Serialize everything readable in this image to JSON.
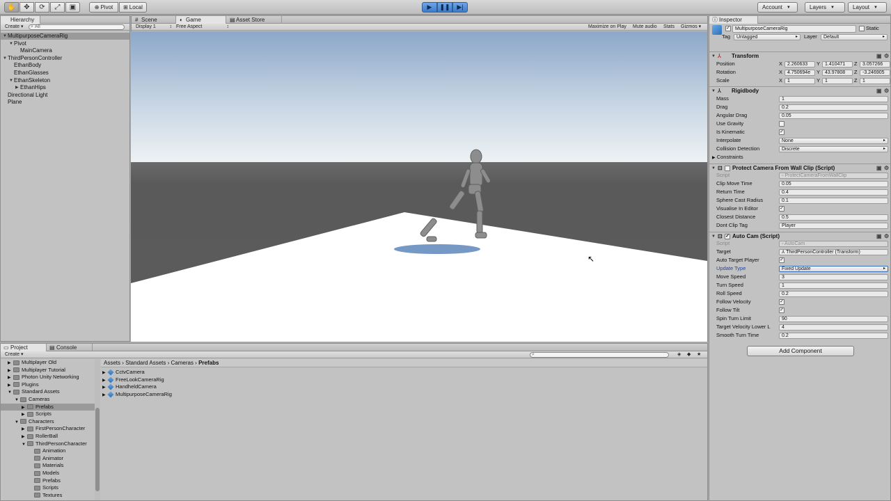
{
  "toolbar": {
    "tools": [
      "hand-icon",
      "move-icon",
      "rotate-icon",
      "scale-icon",
      "rect-icon"
    ],
    "pivot": "Pivot",
    "local": "Local",
    "account": "Account",
    "layers": "Layers",
    "layout": "Layout"
  },
  "hierarchy": {
    "tab": "Hierarchy",
    "create": "Create",
    "search_placeholder": "All",
    "items": [
      {
        "label": "MultipurposeCameraRig",
        "indent": 0,
        "selected": true,
        "expanded": true
      },
      {
        "label": "Pivot",
        "indent": 1,
        "expanded": true
      },
      {
        "label": "MainCamera",
        "indent": 2
      },
      {
        "label": "ThirdPersonController",
        "indent": 0,
        "expanded": true
      },
      {
        "label": "EthanBody",
        "indent": 1
      },
      {
        "label": "EthanGlasses",
        "indent": 1
      },
      {
        "label": "EthanSkeleton",
        "indent": 1,
        "expanded": true
      },
      {
        "label": "EthanHips",
        "indent": 2,
        "collapsed": true
      },
      {
        "label": "Directional Light",
        "indent": 0
      },
      {
        "label": "Plane",
        "indent": 0
      }
    ]
  },
  "center": {
    "tabs": [
      "Scene",
      "Game",
      "Asset Store"
    ],
    "active_tab": "Game",
    "display": "Display 1",
    "aspect": "Free Aspect",
    "options": [
      "Maximize on Play",
      "Mute audio",
      "Stats",
      "Gizmos"
    ]
  },
  "project": {
    "tabs": [
      "Project",
      "Console"
    ],
    "create": "Create",
    "breadcrumb": [
      "Assets",
      "Standard Assets",
      "Cameras",
      "Prefabs"
    ],
    "tree": [
      {
        "label": "Multiplayer Old",
        "indent": 1
      },
      {
        "label": "Multiplayer Tutorial",
        "indent": 1
      },
      {
        "label": "Photon Unity Networking",
        "indent": 1
      },
      {
        "label": "Plugins",
        "indent": 1
      },
      {
        "label": "Standard Assets",
        "indent": 1,
        "expanded": true
      },
      {
        "label": "Cameras",
        "indent": 2,
        "expanded": true
      },
      {
        "label": "Prefabs",
        "indent": 3,
        "selected": true
      },
      {
        "label": "Scripts",
        "indent": 3
      },
      {
        "label": "Characters",
        "indent": 2,
        "expanded": true
      },
      {
        "label": "FirstPersonCharacter",
        "indent": 3
      },
      {
        "label": "RollerBall",
        "indent": 3
      },
      {
        "label": "ThirdPersonCharacter",
        "indent": 3,
        "expanded": true
      },
      {
        "label": "Animation",
        "indent": 4
      },
      {
        "label": "Animator",
        "indent": 4
      },
      {
        "label": "Materials",
        "indent": 4
      },
      {
        "label": "Models",
        "indent": 4
      },
      {
        "label": "Prefabs",
        "indent": 4
      },
      {
        "label": "Scripts",
        "indent": 4
      },
      {
        "label": "Textures",
        "indent": 4
      }
    ],
    "assets": [
      "CctvCamera",
      "FreeLookCameraRig",
      "HandheldCamera",
      "MultipurposeCameraRig"
    ]
  },
  "inspector": {
    "tab": "Inspector",
    "object_name": "MultipurposeCameraRig",
    "static_label": "Static",
    "tag_label": "Tag",
    "tag_value": "Untagged",
    "layer_label": "Layer",
    "layer_value": "Default",
    "transform": {
      "title": "Transform",
      "rows": [
        {
          "label": "Position",
          "x": "2.260633",
          "y": "1.410471",
          "z": "3.057266"
        },
        {
          "label": "Rotation",
          "x": "4.750694e",
          "y": "43.97808",
          "z": "-3.246905"
        },
        {
          "label": "Scale",
          "x": "1",
          "y": "1",
          "z": "1"
        }
      ]
    },
    "rigidbody": {
      "title": "Rigidbody",
      "mass_label": "Mass",
      "mass": "1",
      "drag_label": "Drag",
      "drag": "0.2",
      "angular_drag_label": "Angular Drag",
      "angular_drag": "0.05",
      "use_gravity_label": "Use Gravity",
      "use_gravity": false,
      "is_kinematic_label": "Is Kinematic",
      "is_kinematic": true,
      "interpolate_label": "Interpolate",
      "interpolate": "None",
      "collision_label": "Collision Detection",
      "collision": "Discrete",
      "constraints_label": "Constraints"
    },
    "protect": {
      "title": "Protect Camera From Wall Clip (Script)",
      "script_label": "Script",
      "script": "ProtectCameraFromWallClip",
      "clip_move_label": "Clip Move Time",
      "clip_move": "0.05",
      "return_label": "Return Time",
      "return_time": "0.4",
      "sphere_label": "Sphere Cast Radius",
      "sphere": "0.1",
      "visualise_label": "Visualise In Editor",
      "visualise": true,
      "closest_label": "Closest Distance",
      "closest": "0.5",
      "dont_clip_label": "Dont Clip Tag",
      "dont_clip": "Player"
    },
    "autocam": {
      "title": "Auto Cam (Script)",
      "script_label": "Script",
      "script": "AutoCam",
      "target_label": "Target",
      "target": "ThirdPersonController (Transform)",
      "auto_target_label": "Auto Target Player",
      "auto_target": true,
      "update_label": "Update Type",
      "update": "Fixed Update",
      "move_label": "Move Speed",
      "move": "3",
      "turn_label": "Turn Speed",
      "turn": "1",
      "roll_label": "Roll Speed",
      "roll": "0.2",
      "follow_vel_label": "Follow Velocity",
      "follow_vel": true,
      "follow_tilt_label": "Follow Tilt",
      "follow_tilt": true,
      "spin_label": "Spin Turn Limit",
      "spin": "90",
      "target_vel_label": "Target Velocity Lower L",
      "target_vel": "4",
      "smooth_label": "Smooth Turn Time",
      "smooth": "0.2"
    },
    "add_component": "Add Component"
  },
  "colors": {
    "play_blue": "#4a8ad8",
    "sky_top": "#8fa9c9",
    "horizon": "#dfe6ec",
    "ground": "#595959",
    "plane": "#ffffff",
    "shadow": "#5d86bb"
  }
}
